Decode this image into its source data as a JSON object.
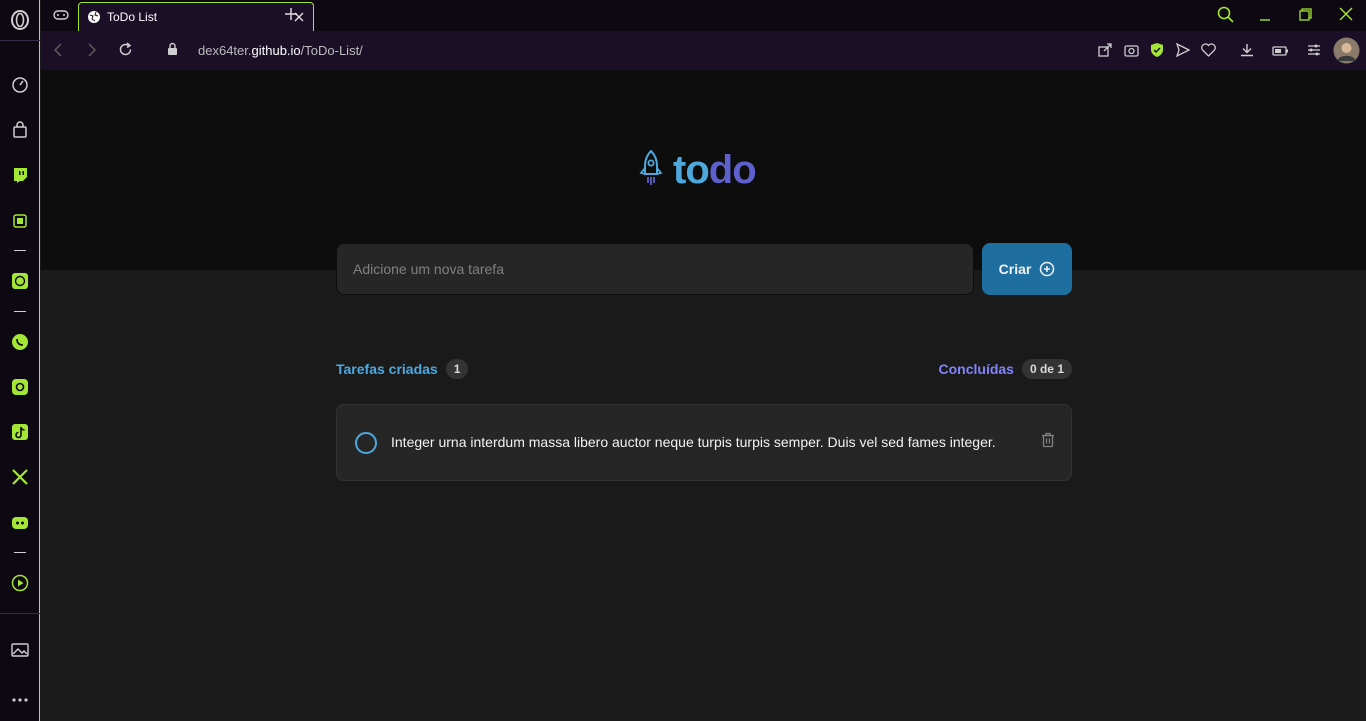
{
  "browser": {
    "tab_title": "ToDo List",
    "url_host_prefix": "dex64ter.",
    "url_host_main": "github.io",
    "url_path": "/ToDo-List/"
  },
  "sidebar": {
    "items": [
      "opera-logo-icon",
      "speed-dial-icon",
      "shopping-icon",
      "twitch-icon",
      "aria-icon",
      "chatgpt-icon",
      "whatsapp-icon",
      "instagram-icon",
      "tiktok-icon",
      "x-icon",
      "discord-icon",
      "player-icon",
      "gallery-icon",
      "more-icon"
    ]
  },
  "app": {
    "logo_to": "to",
    "logo_do": "do",
    "input_placeholder": "Adicione um nova tarefa",
    "create_label": "Criar",
    "created_label": "Tarefas criadas",
    "created_count": "1",
    "done_label": "Concluídas",
    "done_count": "0 de 1",
    "tasks": [
      {
        "text": "Integer urna interdum massa libero auctor neque turpis turpis semper. Duis vel sed fames integer.",
        "done": false
      }
    ]
  },
  "colors": {
    "blue": "#4ea8de",
    "purple": "#5e60ce",
    "purple_light": "#8284fa",
    "blue_dark": "#1e6f9f",
    "accent_green": "#a3e635"
  }
}
